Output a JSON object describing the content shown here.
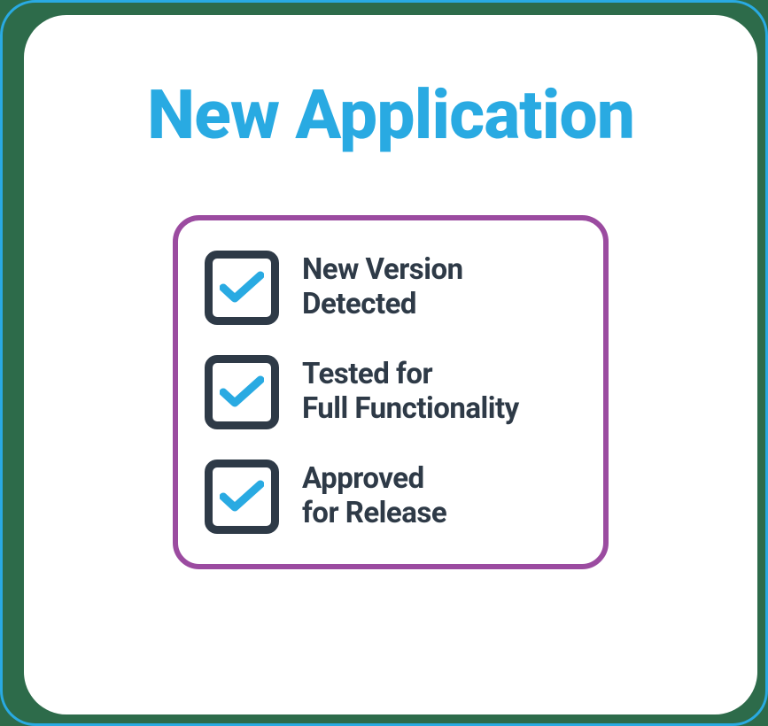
{
  "title": "New Application",
  "checklist": {
    "items": [
      {
        "label": "New Version\nDetected"
      },
      {
        "label": "Tested for\nFull Functionality"
      },
      {
        "label": "Approved\nfor Release"
      }
    ]
  },
  "colors": {
    "accent": "#29aae2",
    "boxBorder": "#9b4ba0",
    "dark": "#2e3a47"
  }
}
